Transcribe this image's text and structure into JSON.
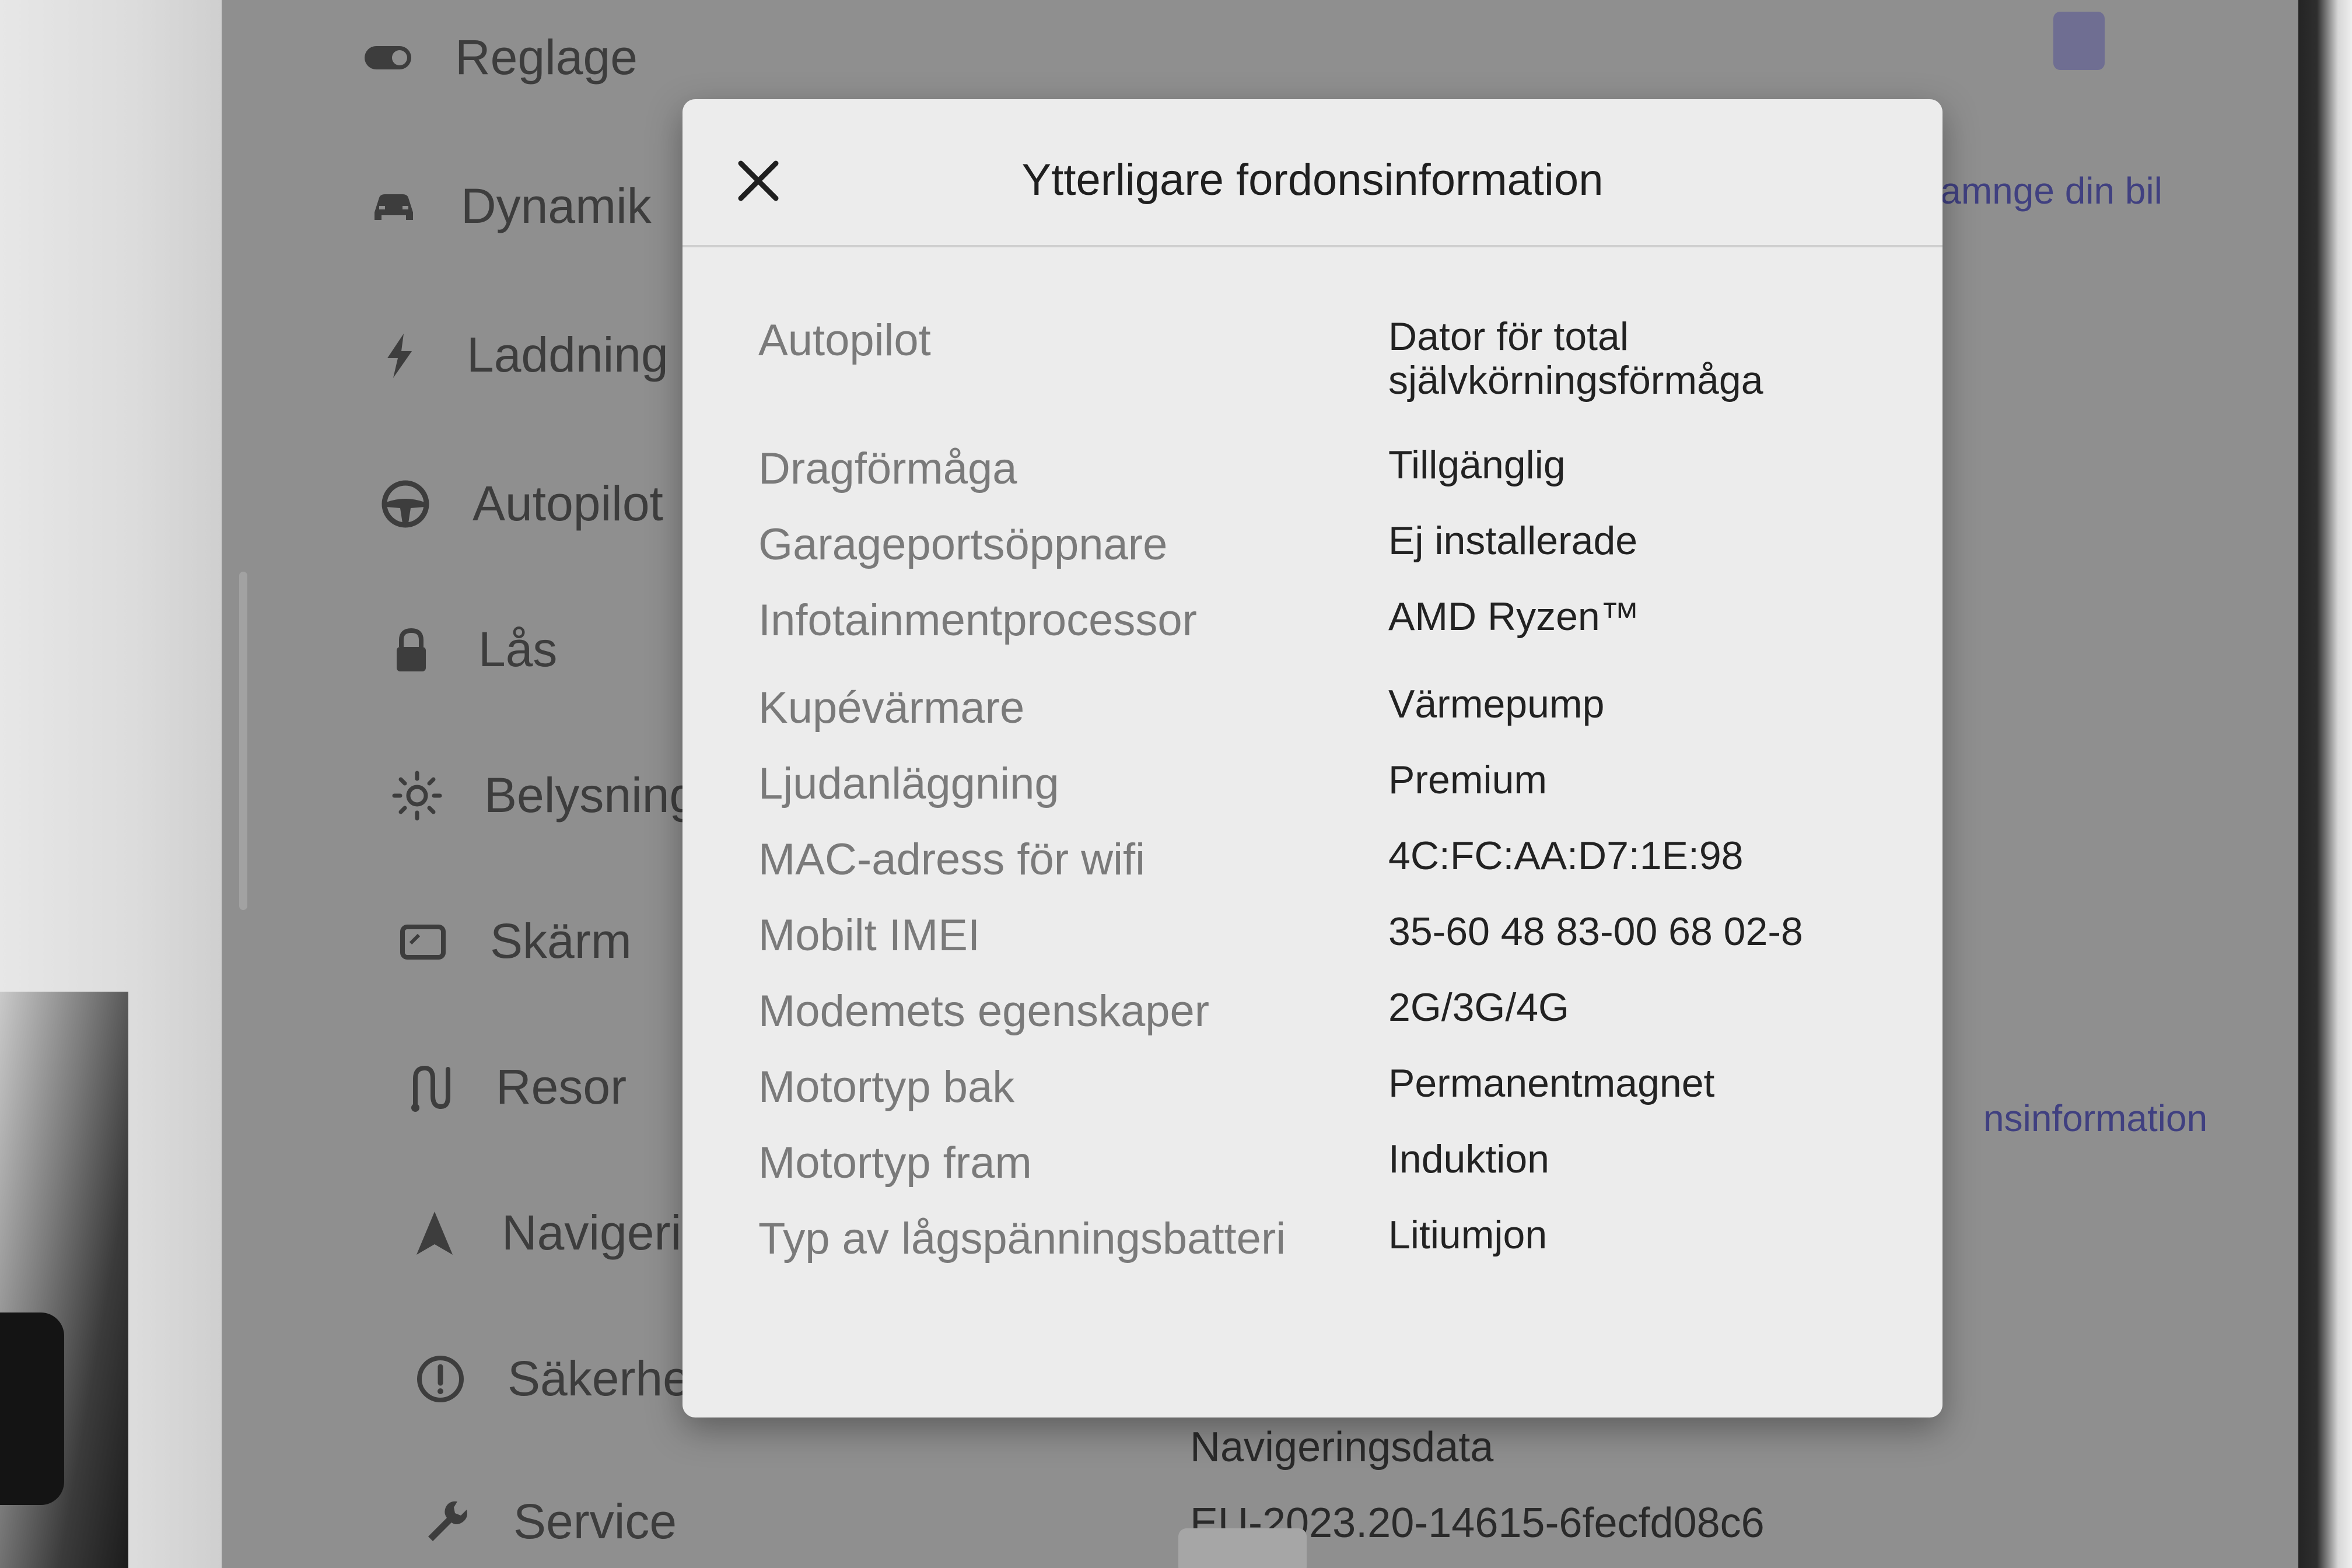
{
  "sidebar": {
    "items": [
      {
        "label": "Reglage",
        "icon": "toggle-icon"
      },
      {
        "label": "Dynamik",
        "icon": "car-icon"
      },
      {
        "label": "Laddning",
        "icon": "lightning-icon"
      },
      {
        "label": "Autopilot",
        "icon": "steering-wheel-icon"
      },
      {
        "label": "Lås",
        "icon": "lock-icon"
      },
      {
        "label": "Belysning",
        "icon": "sun-icon"
      },
      {
        "label": "Skärm",
        "icon": "display-icon"
      },
      {
        "label": "Resor",
        "icon": "route-icon"
      },
      {
        "label": "Navigering",
        "icon": "navigation-arrow-icon"
      },
      {
        "label": "Säkerhet",
        "icon": "alert-circle-icon"
      },
      {
        "label": "Service",
        "icon": "wrench-icon"
      }
    ]
  },
  "background": {
    "name_car_link": "Namnge din bil",
    "more_info_link": "nsinformation",
    "nav_data_label": "Navigeringsdata",
    "nav_data_value": "EU-2023.20-14615-6fecfd08c6"
  },
  "modal": {
    "title": "Ytterligare fordonsinformation",
    "close_icon": "close-icon",
    "rows": [
      {
        "label": "Autopilot",
        "value": "Dator för total självkörningsförmåga"
      },
      {
        "label": "Dragförmåga",
        "value": "Tillgänglig"
      },
      {
        "label": "Garageportsöppnare",
        "value": "Ej installerade"
      },
      {
        "label": "Infotainmentprocessor",
        "value": "AMD Ryzen™"
      },
      {
        "label": "Kupévärmare",
        "value": "Värmepump"
      },
      {
        "label": "Ljudanläggning",
        "value": "Premium"
      },
      {
        "label": "MAC-adress för wifi",
        "value": "4C:FC:AA:D7:1E:98"
      },
      {
        "label": "Mobilt IMEI",
        "value": "35-60 48 83-00 68 02-8"
      },
      {
        "label": "Modemets egenskaper",
        "value": "2G/3G/4G"
      },
      {
        "label": "Motortyp bak",
        "value": "Permanentmagnet"
      },
      {
        "label": "Motortyp fram",
        "value": "Induktion"
      },
      {
        "label": "Typ av lågspänningsbatteri",
        "value": "Litiumjon"
      }
    ]
  },
  "colors": {
    "screen_dim": "#8f8f8f",
    "modal_bg": "#ececec",
    "link": "#404080"
  }
}
